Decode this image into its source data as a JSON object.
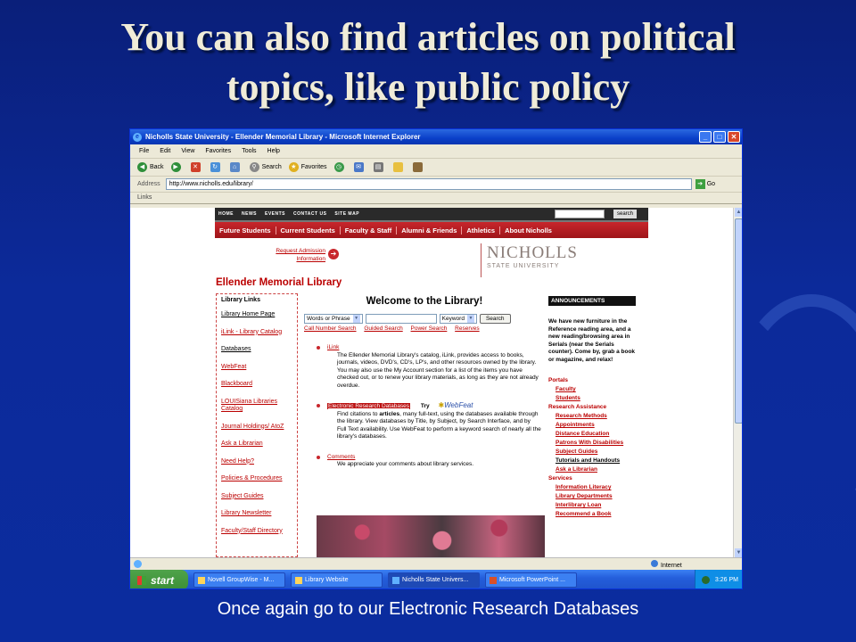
{
  "slide": {
    "title_line1": "You can also find articles on political",
    "title_line2": "topics, like public policy",
    "caption": "Once again go to our Electronic Research Databases"
  },
  "browser": {
    "window_title": "Nicholls State University - Ellender Memorial Library - Microsoft Internet Explorer",
    "menu": [
      "File",
      "Edit",
      "View",
      "Favorites",
      "Tools",
      "Help"
    ],
    "toolbar": {
      "back": "Back",
      "search": "Search",
      "favorites": "Favorites"
    },
    "address_label": "Address",
    "address_value": "http://www.nicholls.edu/library/",
    "go_label": "Go",
    "links_label": "Links",
    "status_zone": "Internet"
  },
  "taskbar": {
    "start_label": "start",
    "tasks": [
      "Novell GroupWise - M...",
      "Library Website",
      "Nicholls State Univers...",
      "Microsoft PowerPoint ..."
    ],
    "clock": "3:26 PM"
  },
  "site": {
    "top_nav": [
      "HOME",
      "NEWS",
      "EVENTS",
      "CONTACT US",
      "SITE MAP"
    ],
    "search_button": "search",
    "red_nav": [
      "Future Students",
      "Current Students",
      "Faculty & Staff",
      "Alumni & Friends",
      "Athletics",
      "About Nicholls"
    ],
    "request_admission": "Request Admission Information",
    "logo_line1": "NICHOLLS",
    "logo_line2": "STATE UNIVERSITY",
    "library_title": "Ellender Memorial Library",
    "library_links_header": "Library Links",
    "library_links": [
      "Library Home Page",
      "iLink - Library Catalog",
      "Databases",
      "WebFeat",
      "Blackboard",
      "LOUISiana Libraries Catalog",
      "Journal Holdings/ AtoZ",
      "Ask a Librarian",
      "Need Help?",
      "Policies & Procedures",
      "Subject Guides",
      "Library Newsletter",
      "Faculty/Staff Directory"
    ],
    "welcome": "Welcome to the Library!",
    "search_select1": "Words or Phrase",
    "search_select2": "Keyword",
    "search_button2": "Search",
    "search_sublinks": [
      "Call Number Search",
      "Guided Search",
      "Power Search",
      "Reserves"
    ],
    "ilink_title": "iLink",
    "ilink_desc": "The Ellender Memorial Library's catalog, iLink, provides access to books, journals, videos, DVD's, CD's, LP's, and other resources owned by the library. You may also use the My Account section for a list of the items you have checked out, or to renew your library materials, as long as they are not already overdue.",
    "erd_title": "Electronic Research Databases",
    "try_label": "Try",
    "webfeat_label": "WebFeat",
    "erd_desc_pre": "Find citations to ",
    "erd_desc_bold": "articles",
    "erd_desc_post": ", many full-text, using the databases available through the library. View databases by Title, by Subject, by Search Interface, and by Full Text availability. Use WebFeat to perform a keyword search of nearly all the library's databases.",
    "comments_title": "Comments",
    "comments_desc": "We appreciate your comments about library services.",
    "announcements_header": "ANNOUNCEMENTS",
    "announcement_text": "We have new furniture in the Reference reading area, and a new reading/browsing area in Serials (near the Serials counter). Come by, grab a book or magazine, and relax!",
    "portals": {
      "portals_label": "Portals",
      "portals_items": [
        "Faculty",
        "Students"
      ],
      "research_label": "Research Assistance",
      "research_items": [
        "Research Methods",
        "Appointments",
        "Distance Education",
        "Patrons With Disabilities",
        "Subject Guides",
        "Tutorials and Handouts",
        "Ask a Librarian"
      ],
      "services_label": "Services",
      "services_items": [
        "Information Literacy",
        "Library Departments",
        "Interlibrary Loan",
        "Recommend a Book"
      ]
    }
  }
}
